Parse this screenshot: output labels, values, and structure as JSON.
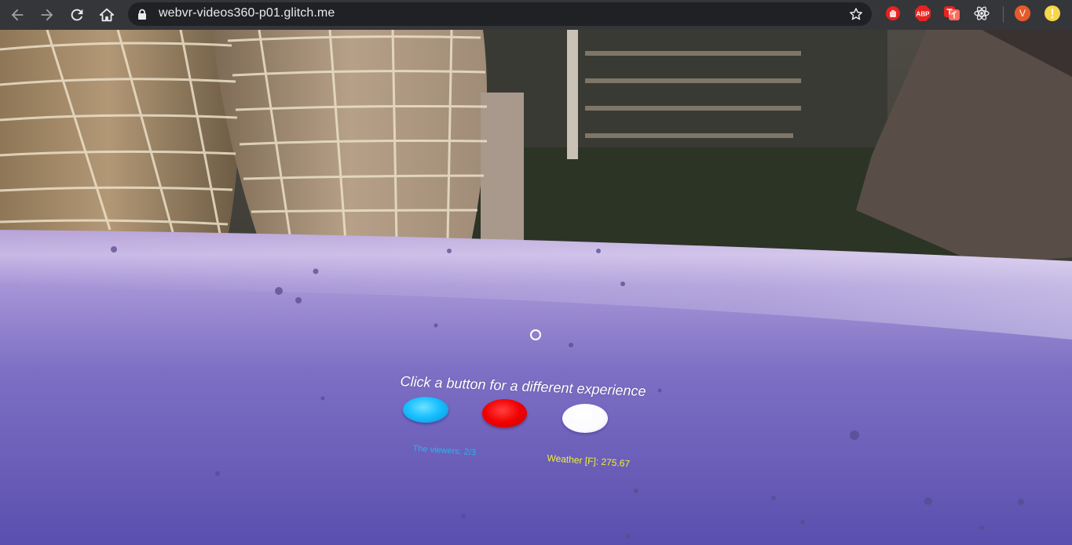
{
  "browser": {
    "url": "webvr-videos360-p01.glitch.me",
    "profile_initial": "V",
    "extensions": [
      "hand-stop-extension-icon",
      "adblock-plus-icon",
      "translate-extension-icon",
      "react-devtools-icon"
    ],
    "extension_labels": {
      "adblock": "ABP"
    }
  },
  "scene": {
    "prompt": "Click a button for a different experience",
    "buttons": [
      {
        "color": "#19c1ff"
      },
      {
        "color": "#f20000"
      },
      {
        "color": "#ffffff"
      }
    ],
    "viewers_text": "The viewers: 2/3",
    "weather_text": "Weather [F]: 275.67"
  }
}
